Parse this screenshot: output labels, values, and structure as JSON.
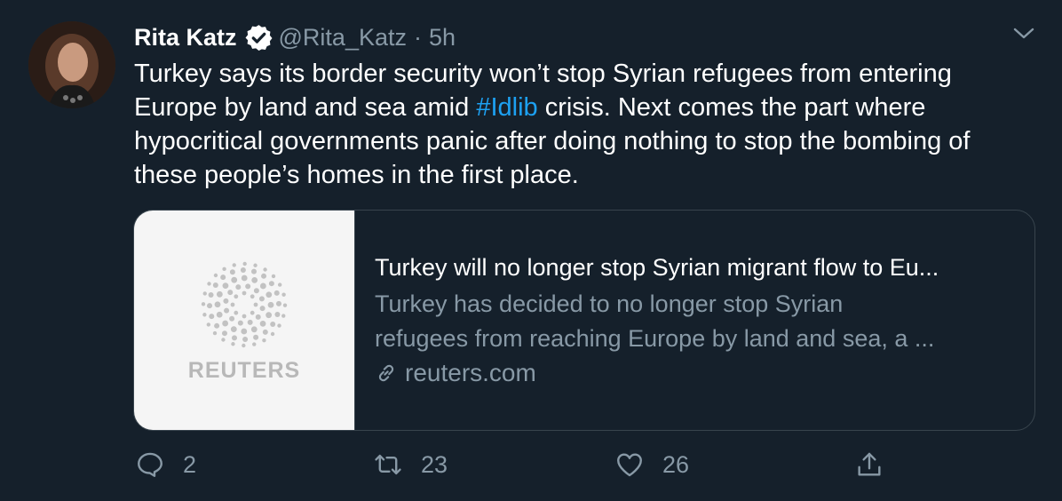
{
  "author": {
    "name": "Rita Katz",
    "handle": "@Rita_Katz",
    "separator": "·",
    "time": "5h",
    "avatar_icon": "profile-photo"
  },
  "tweet": {
    "line1": "Turkey says its border security won’t stop Syrian refugees from entering",
    "line2_pre": "Europe by land and sea amid ",
    "hashtag": "#Idlib",
    "line2_post": " crisis. Next comes the part where",
    "line3": "hypocritical governments panic after doing nothing to stop the bombing of",
    "line4": "these people’s homes in the first place."
  },
  "card": {
    "logo_text": "REUTERS",
    "title": "Turkey will no longer stop Syrian migrant flow to Eu...",
    "description_line1": "Turkey has decided to no longer stop Syrian",
    "description_line2": "refugees from reaching Europe by land and sea, a ...",
    "domain": "reuters.com"
  },
  "actions": {
    "replies": "2",
    "retweets": "23",
    "likes": "26"
  },
  "colors": {
    "background": "#15202b",
    "secondary_text": "#8899a6",
    "accent": "#1da1f2",
    "border": "#38444d"
  }
}
